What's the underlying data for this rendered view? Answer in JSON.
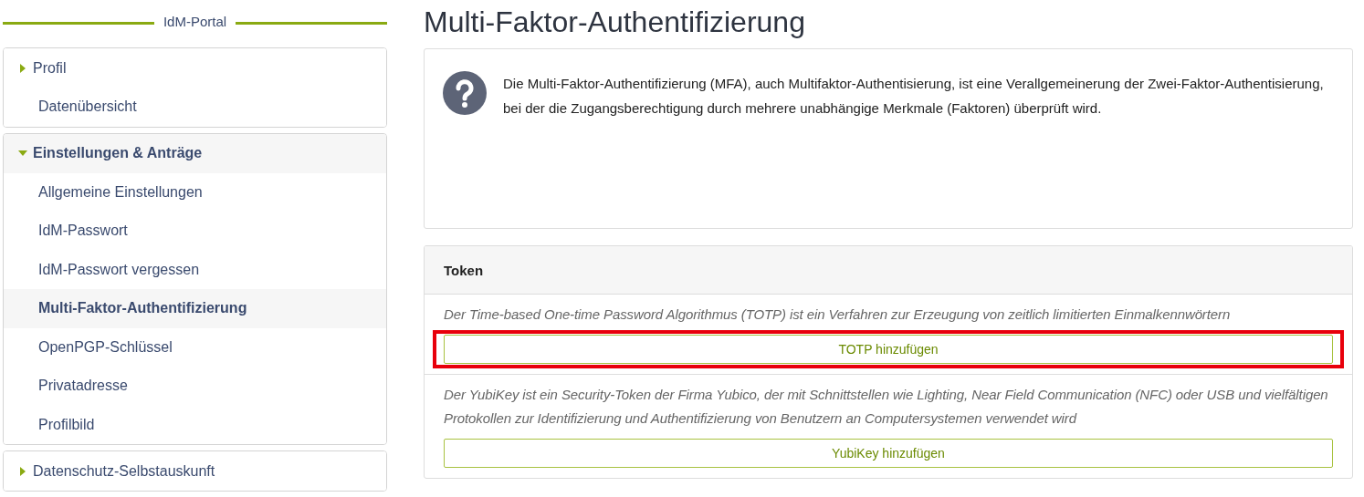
{
  "sidebar": {
    "title": "IdM-Portal",
    "groups": [
      {
        "label": "Profil",
        "expanded": false,
        "items": [
          {
            "label": "Datenübersicht",
            "selected": false
          }
        ]
      },
      {
        "label": "Einstellungen & Anträge",
        "expanded": true,
        "items": [
          {
            "label": "Allgemeine Einstellungen",
            "selected": false
          },
          {
            "label": "IdM-Passwort",
            "selected": false
          },
          {
            "label": "IdM-Passwort vergessen",
            "selected": false
          },
          {
            "label": "Multi-Faktor-Authentifizierung",
            "selected": true
          },
          {
            "label": "OpenPGP-Schlüssel",
            "selected": false
          },
          {
            "label": "Privatadresse",
            "selected": false
          },
          {
            "label": "Profilbild",
            "selected": false
          }
        ]
      },
      {
        "label": "Datenschutz-Selbstauskunft",
        "expanded": false
      }
    ]
  },
  "page_title": "Multi-Faktor-Authentifizierung",
  "info": {
    "text": "Die Multi-Faktor-Authentifizierung (MFA), auch Multifaktor-Authentisierung, ist eine Verallgemeinerung der Zwei-Faktor-Authentisierung, bei der die Zugangsberechtigung durch mehrere unabhängige Merkmale (Faktoren) überprüft wird."
  },
  "token_panel": {
    "title": "Token",
    "options": [
      {
        "description": "Der Time-based One-time Password Algorithmus (TOTP) ist ein Verfahren zur Erzeugung von zeitlich limitierten Einmalkennwörtern",
        "button": "TOTP hinzufügen",
        "highlighted": true
      },
      {
        "description": "Der YubiKey ist ein Security-Token der Firma Yubico, der mit Schnittstellen wie Lighting, Near Field Communication (NFC) oder USB und vielfältigen Protokollen zur Identifizierung und Authentifizierung von Benutzern an Computersystemen verwendet wird",
        "button": "YubiKey hinzufügen",
        "highlighted": false
      }
    ]
  }
}
